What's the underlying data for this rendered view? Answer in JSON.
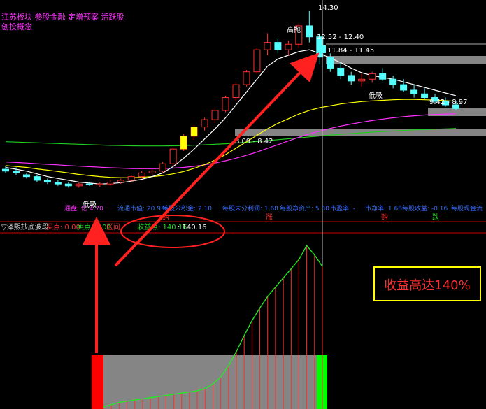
{
  "title_lines": [
    "江苏板块 参股金融 定增预案 活跃股",
    "创投概念"
  ],
  "colors": {
    "up": "#ff3030",
    "down": "#54ffff",
    "ma_white": "#ffffff",
    "ma_yellow": "#ffff00",
    "ma_magenta": "#ff33ff",
    "ma_green": "#22cc22",
    "axis": "#cc0000",
    "info_blue": "#3a6cff",
    "info_magenta": "#ff33ff",
    "arrow": "#ff2020",
    "box_gold": "#ffff00",
    "grey_fill": "#858585",
    "green_bar": "#00ff00"
  },
  "price_labels": {
    "high": "14.30",
    "tag_gaopi": "高抛",
    "r1": "12.52 - 12.40",
    "r2": "11.84 - 11.45",
    "r3": "9.42 - 8.97",
    "r4": "8.09 - 8.42",
    "tag_dixi": "低吸",
    "low": "4.70",
    "tag_low": "低吸"
  },
  "info_row": {
    "items": [
      "通盘: 亿 4.70",
      "流通市值: 20.93亿",
      "每股公积金: 2.10",
      "每股未分利润: 1.68",
      "每股净资产: 5.30",
      "市盈率: -",
      "市净率: 1.68",
      "每股收益: -0.16",
      "每股现金流"
    ],
    "marks": [
      "购",
      "涨",
      "跌"
    ]
  },
  "indicator": {
    "name": "▽泽熙抄底波段",
    "buy_label": "买点: 0.00",
    "sell_label": "卖点: 0.00",
    "range_label": "区间",
    "profit_label": "收益点: 140.16",
    "profit_value": ": 140.16"
  },
  "callout": "收益高达140%",
  "chart_data": {
    "type": "candlestick",
    "title": "",
    "price_axis_ylim": [
      3.5,
      14.6
    ],
    "candles": [
      [
        5.7,
        5.9,
        5.5,
        5.6
      ],
      [
        5.6,
        5.8,
        5.4,
        5.5
      ],
      [
        5.4,
        5.5,
        5.2,
        5.3
      ],
      [
        5.3,
        5.4,
        5.0,
        5.1
      ],
      [
        5.1,
        5.2,
        4.9,
        5.0
      ],
      [
        5.0,
        5.1,
        4.8,
        4.9
      ],
      [
        4.9,
        5.0,
        4.7,
        4.8
      ],
      [
        4.8,
        5.0,
        4.7,
        4.9
      ],
      [
        4.9,
        5.0,
        4.8,
        4.85
      ],
      [
        4.85,
        5.0,
        4.75,
        4.9
      ],
      [
        4.9,
        5.1,
        4.8,
        5.0
      ],
      [
        5.0,
        5.2,
        4.9,
        5.1
      ],
      [
        5.1,
        5.4,
        5.0,
        5.3
      ],
      [
        5.3,
        5.6,
        5.2,
        5.5
      ],
      [
        5.5,
        5.7,
        5.4,
        5.6
      ],
      [
        5.6,
        6.1,
        5.5,
        6.0
      ],
      [
        6.0,
        6.9,
        5.9,
        6.8
      ],
      [
        6.8,
        7.6,
        6.7,
        7.5
      ],
      [
        7.5,
        8.1,
        7.3,
        8.0
      ],
      [
        8.0,
        8.5,
        7.8,
        8.4
      ],
      [
        8.4,
        9.0,
        8.2,
        8.9
      ],
      [
        8.9,
        9.7,
        8.8,
        9.6
      ],
      [
        9.6,
        10.4,
        9.4,
        10.3
      ],
      [
        10.3,
        11.1,
        10.2,
        11.0
      ],
      [
        11.0,
        12.3,
        10.9,
        12.2
      ],
      [
        12.2,
        13.1,
        11.9,
        12.6
      ],
      [
        12.6,
        12.8,
        12.0,
        12.2
      ],
      [
        12.2,
        12.7,
        11.9,
        12.5
      ],
      [
        12.5,
        13.6,
        12.3,
        13.5
      ],
      [
        13.5,
        14.3,
        12.6,
        12.9
      ],
      [
        12.9,
        13.1,
        11.4,
        11.8
      ],
      [
        11.8,
        12.0,
        11.0,
        11.2
      ],
      [
        11.2,
        11.5,
        10.6,
        10.8
      ],
      [
        10.8,
        11.0,
        10.3,
        10.5
      ],
      [
        10.5,
        10.9,
        10.2,
        10.6
      ],
      [
        10.6,
        11.0,
        10.4,
        10.9
      ],
      [
        10.9,
        11.2,
        10.5,
        10.6
      ],
      [
        10.6,
        10.8,
        10.1,
        10.3
      ],
      [
        10.3,
        10.6,
        9.9,
        10.0
      ],
      [
        10.0,
        10.3,
        9.6,
        9.8
      ],
      [
        9.8,
        10.1,
        9.5,
        9.6
      ],
      [
        9.6,
        9.8,
        9.3,
        9.4
      ],
      [
        9.4,
        9.6,
        9.1,
        9.2
      ],
      [
        9.2,
        9.4,
        8.9,
        9.0
      ]
    ],
    "ma_short": [
      5.8,
      5.7,
      5.6,
      5.45,
      5.3,
      5.2,
      5.1,
      5.0,
      4.95,
      4.9,
      4.92,
      4.97,
      5.05,
      5.15,
      5.3,
      5.5,
      5.85,
      6.3,
      6.8,
      7.35,
      7.9,
      8.5,
      9.2,
      9.9,
      10.6,
      11.3,
      11.7,
      11.9,
      12.1,
      12.2,
      12.0,
      11.75,
      11.5,
      11.2,
      10.95,
      10.8,
      10.7,
      10.6,
      10.45,
      10.3,
      10.15,
      10.0,
      9.85,
      9.7
    ],
    "ma_mid": [
      5.9,
      5.85,
      5.8,
      5.72,
      5.65,
      5.58,
      5.5,
      5.42,
      5.36,
      5.3,
      5.26,
      5.24,
      5.24,
      5.26,
      5.3,
      5.36,
      5.45,
      5.58,
      5.75,
      5.95,
      6.2,
      6.5,
      6.85,
      7.2,
      7.55,
      7.9,
      8.2,
      8.45,
      8.7,
      8.9,
      9.05,
      9.15,
      9.25,
      9.32,
      9.38,
      9.42,
      9.45,
      9.48,
      9.5,
      9.5,
      9.48,
      9.46,
      9.43,
      9.4
    ],
    "ma_long": [
      6.1,
      6.07,
      6.04,
      6.0,
      5.97,
      5.94,
      5.9,
      5.87,
      5.84,
      5.81,
      5.78,
      5.76,
      5.74,
      5.73,
      5.73,
      5.74,
      5.76,
      5.8,
      5.86,
      5.94,
      6.04,
      6.16,
      6.3,
      6.46,
      6.64,
      6.84,
      7.04,
      7.24,
      7.44,
      7.62,
      7.78,
      7.92,
      8.05,
      8.16,
      8.26,
      8.35,
      8.43,
      8.5,
      8.56,
      8.61,
      8.65,
      8.68,
      8.7,
      8.72
    ],
    "ma_longest": [
      7.2,
      7.18,
      7.16,
      7.14,
      7.12,
      7.1,
      7.08,
      7.06,
      7.04,
      7.02,
      7.0,
      6.99,
      6.98,
      6.97,
      6.97,
      6.97,
      6.98,
      6.99,
      7.01,
      7.03,
      7.06,
      7.09,
      7.13,
      7.17,
      7.21,
      7.26,
      7.31,
      7.36,
      7.41,
      7.46,
      7.51,
      7.56,
      7.6,
      7.64,
      7.68,
      7.72,
      7.75,
      7.78,
      7.81,
      7.84,
      7.86,
      7.88,
      7.9,
      7.92
    ],
    "indicator_profit": [
      0,
      2,
      4,
      5,
      6,
      7,
      8,
      9,
      10,
      11,
      12,
      13,
      14,
      16,
      20,
      26,
      36,
      48,
      62,
      75,
      86,
      96,
      104,
      112,
      120,
      128,
      140.16,
      132,
      122
    ],
    "indicator_ylim": [
      0,
      150
    ]
  }
}
